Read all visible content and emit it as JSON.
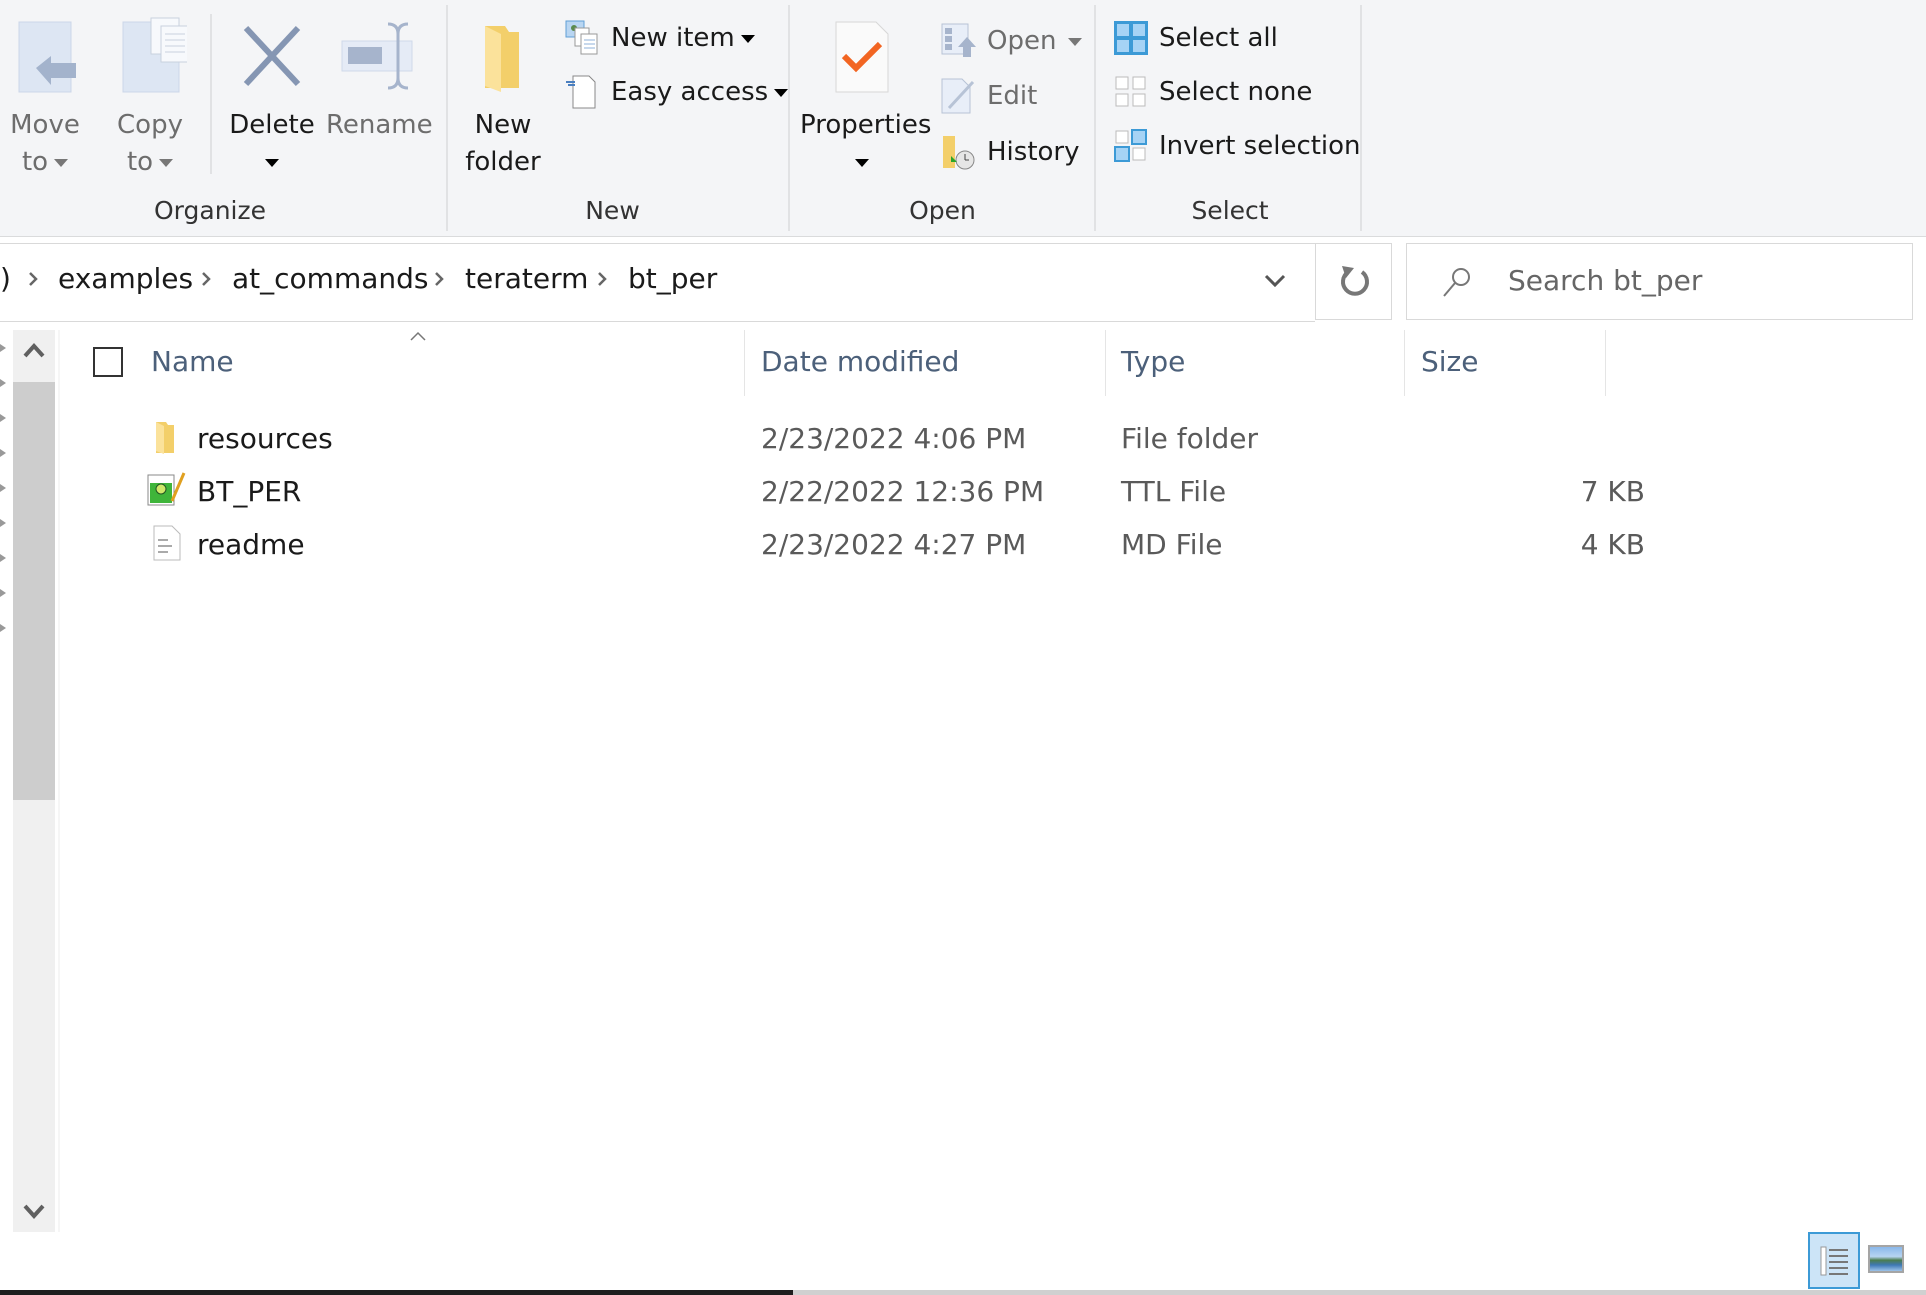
{
  "ribbon": {
    "groups": {
      "organize": {
        "label": "Organize",
        "move_to": {
          "line1": "Move",
          "line2": "to",
          "icon": "move-to-icon",
          "enabled": false
        },
        "copy_to": {
          "line1": "Copy",
          "line2": "to",
          "icon": "copy-to-icon",
          "enabled": false
        },
        "delete": {
          "label": "Delete",
          "icon": "delete-x-icon",
          "enabled": true
        },
        "rename": {
          "label": "Rename",
          "icon": "rename-icon",
          "enabled": false
        }
      },
      "new": {
        "label": "New",
        "new_folder": {
          "line1": "New",
          "line2": "folder",
          "icon": "new-folder-icon"
        },
        "new_item": {
          "label": "New item",
          "icon": "new-item-icon"
        },
        "easy_access": {
          "label": "Easy access",
          "icon": "easy-access-icon"
        }
      },
      "open": {
        "label": "Open",
        "properties": {
          "label": "Properties",
          "icon": "properties-checkmark-icon"
        },
        "open": {
          "label": "Open",
          "icon": "open-icon",
          "enabled": false
        },
        "edit": {
          "label": "Edit",
          "icon": "edit-icon",
          "enabled": false
        },
        "history": {
          "label": "History",
          "icon": "history-icon"
        }
      },
      "select": {
        "label": "Select",
        "select_all": {
          "label": "Select all",
          "icon": "select-all-icon"
        },
        "select_none": {
          "label": "Select none",
          "icon": "select-none-icon"
        },
        "invert_selection": {
          "label": "Invert selection",
          "icon": "invert-selection-icon"
        }
      }
    }
  },
  "address": {
    "truncated_prefix": ")",
    "breadcrumbs": [
      "examples",
      "at_commands",
      "teraterm",
      "bt_per"
    ]
  },
  "search": {
    "placeholder": "Search bt_per"
  },
  "columns": {
    "name": "Name",
    "date": "Date modified",
    "type": "Type",
    "size": "Size"
  },
  "files": [
    {
      "name": "resources",
      "date": "2/23/2022 4:06 PM",
      "type": "File folder",
      "size": "",
      "icon": "folder-icon"
    },
    {
      "name": "BT_PER",
      "date": "2/22/2022 12:36 PM",
      "type": "TTL File",
      "size": "7 KB",
      "icon": "teraterm-macro-icon"
    },
    {
      "name": "readme",
      "date": "2/23/2022 4:27 PM",
      "type": "MD File",
      "size": "4 KB",
      "icon": "text-document-icon"
    }
  ],
  "colors": {
    "ribbon_bg": "#f4f5f7",
    "header_text": "#4c607a",
    "accent": "#3c9ad6",
    "selection_bg": "#cce4f7"
  },
  "view": {
    "active": "details"
  }
}
